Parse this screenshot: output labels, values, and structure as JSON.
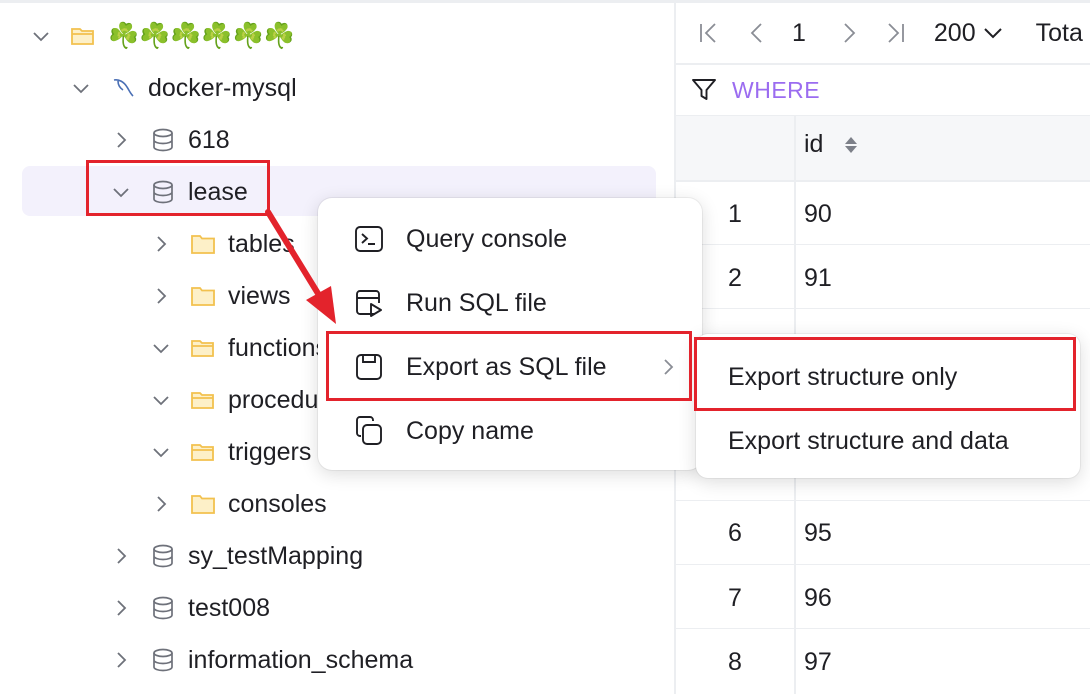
{
  "tree": {
    "group_label": "☘️☘️☘️☘️☘️☘️",
    "connection_label": "docker-mysql",
    "databases": {
      "db_618": "618",
      "db_lease": "lease",
      "db_sy": "sy_testMapping",
      "db_test008": "test008",
      "db_info": "information_schema"
    },
    "folders": {
      "tables": "tables",
      "views": "views",
      "functions": "functions",
      "procedures": "procedures",
      "triggers": "triggers",
      "consoles": "consoles"
    }
  },
  "pager": {
    "page": "1",
    "page_size": "200",
    "total_label": "Tota"
  },
  "filter": {
    "where_label": "WHERE"
  },
  "grid": {
    "column_id": "id",
    "rows": [
      {
        "num": "1",
        "id": "90"
      },
      {
        "num": "2",
        "id": "91"
      },
      {
        "num": "6",
        "id": "95"
      },
      {
        "num": "7",
        "id": "96"
      },
      {
        "num": "8",
        "id": "97"
      }
    ]
  },
  "context_menu": {
    "query_console": "Query console",
    "run_sql_file": "Run SQL file",
    "export_sql_file": "Export as SQL file",
    "copy_name": "Copy name"
  },
  "export_submenu": {
    "structure_only": "Export structure only",
    "structure_and_data": "Export structure and data"
  },
  "colors": {
    "highlight": "#e3232c",
    "accent_purple": "#9b6cf0",
    "folder_yellow": "#f2c14e",
    "selection_bg": "#f3f1fc"
  }
}
